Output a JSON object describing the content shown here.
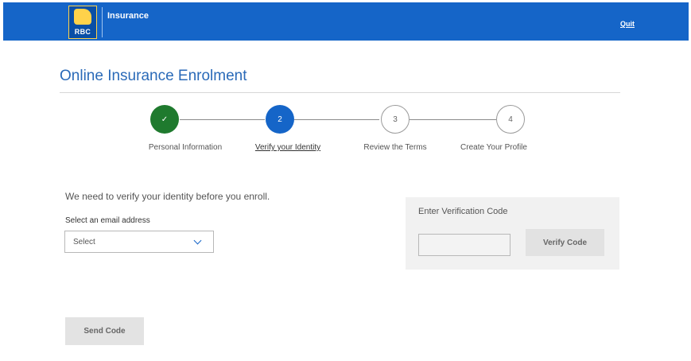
{
  "header": {
    "logo_text": "RBC",
    "brand": "Insurance",
    "quit_label": "Quit"
  },
  "page": {
    "title": "Online Insurance Enrolment"
  },
  "steps": [
    {
      "number": "✓",
      "label": "Personal Information",
      "state": "complete"
    },
    {
      "number": "2",
      "label": "Verify your Identity",
      "state": "current"
    },
    {
      "number": "3",
      "label": "Review the Terms",
      "state": "upcoming"
    },
    {
      "number": "4",
      "label": "Create Your Profile",
      "state": "upcoming"
    }
  ],
  "form": {
    "intro": "We need to verify your identity before you enroll.",
    "email_label": "Select an email address",
    "email_select_value": "Select",
    "send_code_label": "Send Code"
  },
  "verification": {
    "title": "Enter Verification Code",
    "code_value": "",
    "verify_label": "Verify Code"
  },
  "colors": {
    "brand_blue": "#1565c8",
    "complete_green": "#1f7a2e",
    "brand_gold": "#ffd24a"
  }
}
